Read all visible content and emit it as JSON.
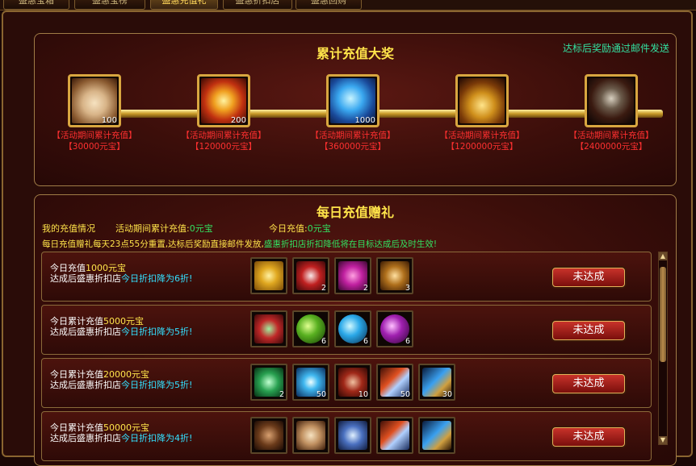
{
  "tabs": [
    "盛惠宝箱",
    "盛惠宝榜",
    "盛惠充值礼",
    "盛惠折扣店",
    "盛惠回购"
  ],
  "accumulated": {
    "title": "累计充值大奖",
    "note": "达标后奖励通过邮件发送",
    "milestones": [
      {
        "qty": "100",
        "label": "【活动期间累计充值】",
        "amount": "【30000元宝】",
        "icon": "pouch-icon"
      },
      {
        "qty": "200",
        "label": "【活动期间累计充值】",
        "amount": "【120000元宝】",
        "icon": "sun-medal-icon"
      },
      {
        "qty": "1000",
        "label": "【活动期间累计充值】",
        "amount": "【360000元宝】",
        "icon": "potion-bottle-icon"
      },
      {
        "qty": "",
        "label": "【活动期间累计充值】",
        "amount": "【1200000元宝】",
        "icon": "golden-bell-icon"
      },
      {
        "qty": "",
        "label": "【活动期间累计充值】",
        "amount": "【2400000元宝】",
        "icon": "dark-armor-icon"
      }
    ]
  },
  "daily": {
    "title": "每日充值赠礼",
    "my_status_label": "我的充值情况",
    "period_label": "活动期间累计充值:",
    "period_value": "0元宝",
    "today_label": "今日充值:",
    "today_value": "0元宝",
    "banner_a": "每日充值赠礼每天23点55分重置,达标后奖励直接邮件发放,",
    "banner_b": "盛惠折扣店折扣降低将在目标达成后及时生效!",
    "rows": [
      {
        "line1_prefix": "今日充值",
        "line1_amount": "1000元宝",
        "line2_prefix": "达成后盛惠折扣店",
        "line2_highlight": "今日折扣降为6折!",
        "button": "未达成",
        "items": [
          {
            "icon": "gold-ingots-icon",
            "qty": ""
          },
          {
            "icon": "red-rune-icon",
            "qty": "2"
          },
          {
            "icon": "pink-orbs-icon",
            "qty": "2"
          },
          {
            "icon": "bronze-compass-icon",
            "qty": "3"
          }
        ]
      },
      {
        "line1_prefix": "今日累计充值",
        "line1_amount": "5000元宝",
        "line2_prefix": "达成后盛惠折扣店",
        "line2_highlight": "今日折扣降为5折!",
        "button": "未达成",
        "items": [
          {
            "icon": "jewel-chest-icon",
            "qty": ""
          },
          {
            "icon": "green-orb-icon",
            "qty": "6"
          },
          {
            "icon": "blue-orb-icon",
            "qty": "6"
          },
          {
            "icon": "purple-orb-icon",
            "qty": "6"
          }
        ]
      },
      {
        "line1_prefix": "今日累计充值",
        "line1_amount": "20000元宝",
        "line2_prefix": "达成后盛惠折扣店",
        "line2_highlight": "今日折扣降为5折!",
        "button": "未达成",
        "items": [
          {
            "icon": "green-heart-gem-icon",
            "qty": "2"
          },
          {
            "icon": "blue-swirl-icon",
            "qty": "50"
          },
          {
            "icon": "red-scroll-icon",
            "qty": "10"
          },
          {
            "icon": "red-potion-icon",
            "qty": "50"
          },
          {
            "icon": "blue-potion-icon",
            "qty": "30"
          }
        ]
      },
      {
        "line1_prefix": "今日累计充值",
        "line1_amount": "50000元宝",
        "line2_prefix": "达成后盛惠折扣店",
        "line2_highlight": "今日折扣降为4折!",
        "button": "未达成",
        "items": [
          {
            "icon": "wooden-box-icon",
            "qty": ""
          },
          {
            "icon": "pouch-icon",
            "qty": ""
          },
          {
            "icon": "blue-wreath-icon",
            "qty": ""
          },
          {
            "icon": "red-potion-icon",
            "qty": ""
          },
          {
            "icon": "blue-potion-icon",
            "qty": ""
          }
        ]
      }
    ]
  }
}
